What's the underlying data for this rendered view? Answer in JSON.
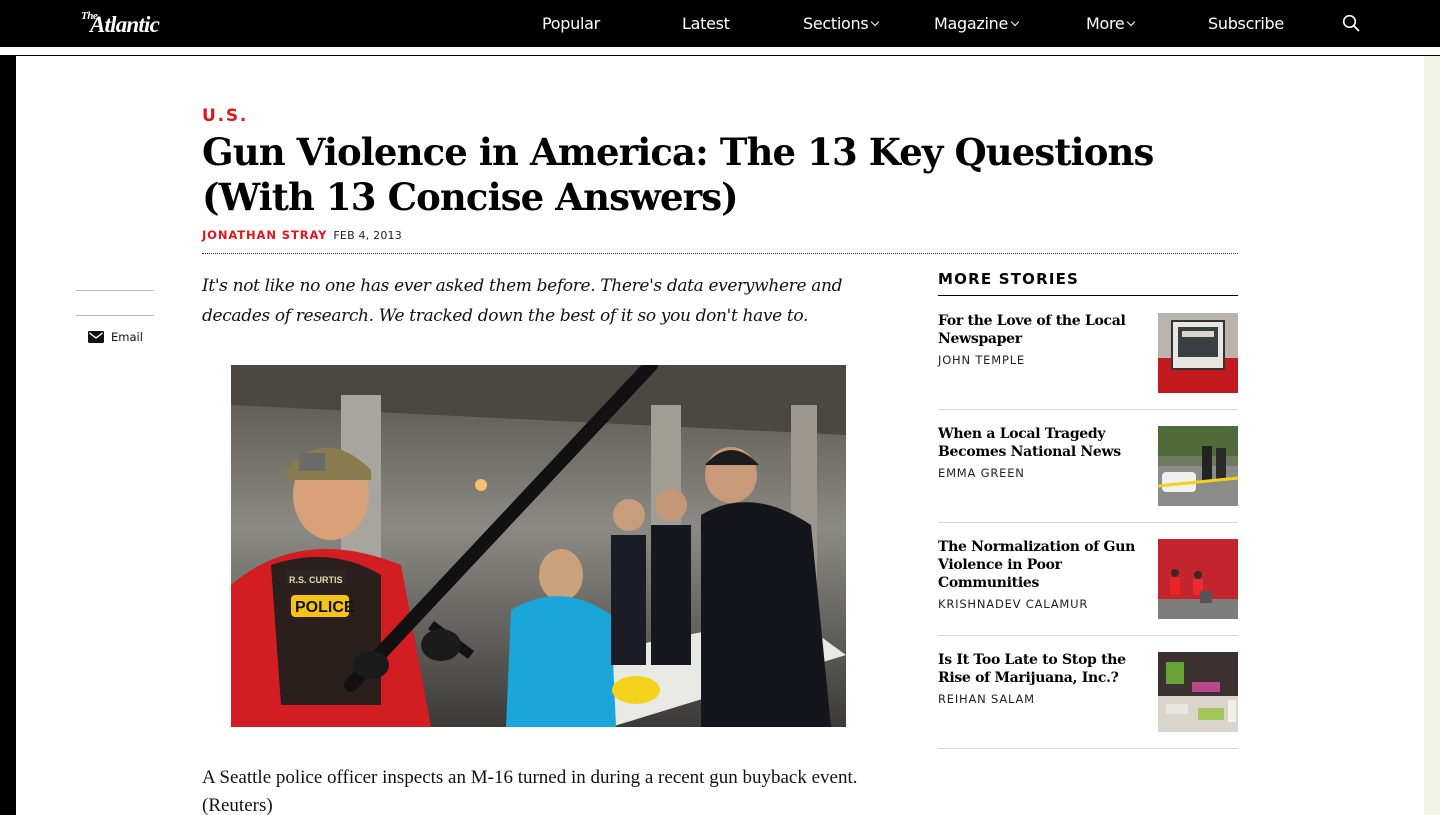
{
  "nav": {
    "logo_the": "The",
    "logo_name": "Atlantic",
    "items": [
      {
        "label": "Popular",
        "dropdown": false
      },
      {
        "label": "Latest",
        "dropdown": false
      },
      {
        "label": "Sections",
        "dropdown": true
      },
      {
        "label": "Magazine",
        "dropdown": true
      },
      {
        "label": "More",
        "dropdown": true
      },
      {
        "label": "Subscribe",
        "dropdown": false
      }
    ],
    "search_icon": "search-icon"
  },
  "article": {
    "section": "U.S.",
    "headline": "Gun Violence in America: The 13 Key Questions (With 13 Concise Answers)",
    "author": "JONATHAN STRAY",
    "date": "FEB 4, 2013",
    "dek": "It's not like no one has ever asked them before. There's data everywhere and decades of research. We tracked down the best of it so you don't have to.",
    "photo_text": "R.S. CURTIS",
    "photo_badge": "POLICE",
    "caption": "A Seattle police officer inspects an M-16 turned in during a recent gun buyback event. (Reuters)"
  },
  "share": {
    "email_label": "Email",
    "email_icon": "envelope-icon"
  },
  "more_stories": {
    "heading": "MORE STORIES",
    "items": [
      {
        "title": "For the Love of the Local Newspaper",
        "author": "JOHN TEMPLE"
      },
      {
        "title": "When a Local Tragedy Becomes National News",
        "author": "EMMA GREEN"
      },
      {
        "title": "The Normalization of Gun Violence in Poor Communities",
        "author": "KRISHNADEV CALAMUR"
      },
      {
        "title": "Is It Too Late to Stop the Rise of Marijuana, Inc.?",
        "author": "REIHAN SALAM"
      }
    ]
  },
  "colors": {
    "accent_red": "#e7131a",
    "nav_bg": "#000000",
    "page_bg": "#ffffff"
  }
}
